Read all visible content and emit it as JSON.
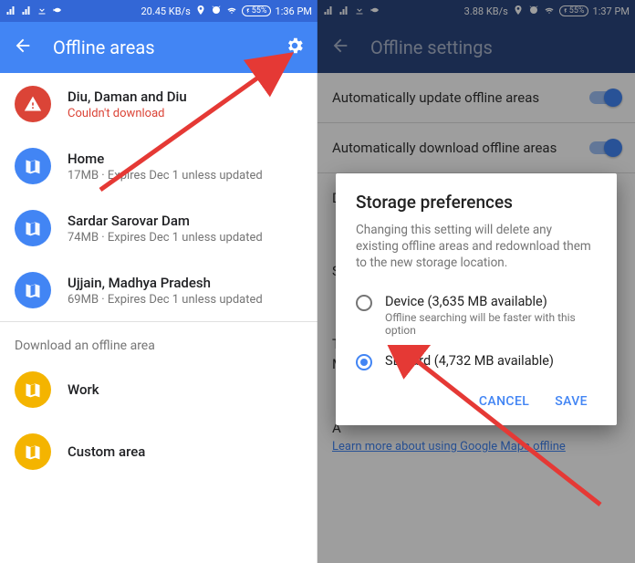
{
  "left": {
    "status": {
      "data_rate": "20.45 KB/s",
      "battery": "55%",
      "time": "1:36 PM"
    },
    "appbar": {
      "title": "Offline areas"
    },
    "areas": [
      {
        "title": "Diu, Daman and Diu",
        "subtitle": "Couldn't download",
        "state": "error"
      },
      {
        "title": "Home",
        "subtitle": "17MB · Expires Dec 1 unless updated",
        "state": "ok"
      },
      {
        "title": "Sardar Sarovar Dam",
        "subtitle": "74MB · Expires Dec 1 unless updated",
        "state": "ok"
      },
      {
        "title": "Ujjain, Madhya Pradesh",
        "subtitle": "69MB · Expires Dec 1 unless updated",
        "state": "ok"
      }
    ],
    "download_section_label": "Download an offline area",
    "download_items": [
      {
        "title": "Work"
      },
      {
        "title": "Custom area"
      }
    ]
  },
  "right": {
    "status": {
      "data_rate": "3.88 KB/s",
      "battery": "55%",
      "time": "1:37 PM"
    },
    "appbar": {
      "title": "Offline settings"
    },
    "settings": {
      "auto_update_label": "Automatically update offline areas",
      "auto_download_label": "Automatically download offline areas",
      "row_d": "D",
      "row_s": "S",
      "row_t": "T",
      "row_m": "M",
      "row_a": "A",
      "learn_more": "Learn more about using Google Maps offline"
    },
    "dialog": {
      "title": "Storage preferences",
      "body": "Changing this setting will delete any existing offline areas and redownload them to the new storage location.",
      "option_device_label": "Device (3,635 MB available)",
      "option_device_sub": "Offline searching will be faster with this option",
      "option_sd_label": "SD card (4,732 MB available)",
      "cancel": "CANCEL",
      "save": "SAVE"
    }
  }
}
